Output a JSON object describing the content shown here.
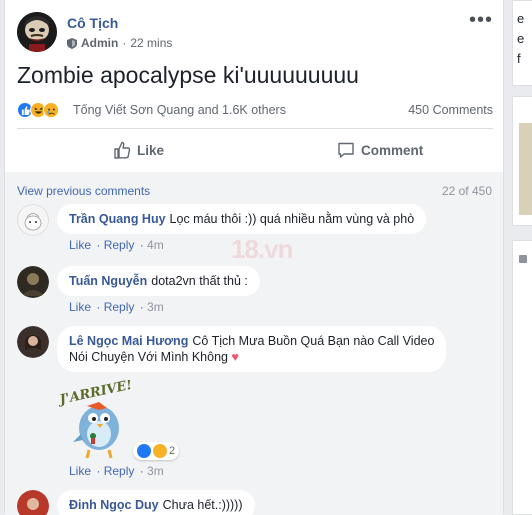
{
  "post": {
    "author": "Cô Tịch",
    "role": "Admin",
    "time": "22 mins",
    "text": "Zombie apocalypse ki'uuuuuuuuu",
    "reactors": "Tống Viết Sơn Quang and 1.6K others",
    "comments_count": "450 Comments",
    "like_label": "Like",
    "comment_label": "Comment"
  },
  "comments_section": {
    "view_previous": "View previous comments",
    "count_of": "22 of 450",
    "items": [
      {
        "name": "Trần Quang Huy",
        "text": "Lọc máu thôi :)) quá nhiều nằm vùng và phò",
        "like": "Like",
        "reply": "Reply",
        "time": "4m"
      },
      {
        "name": "Tuấn Nguyễn",
        "text": "dota2vn thất thủ :",
        "like": "Like",
        "reply": "Reply",
        "time": "3m"
      },
      {
        "name": "Lê Ngọc Mai Hương",
        "text_line1": "Cô Tịch Mưa Buồn Quá Bạn nào Call Video",
        "text_line2": "Nói Chuyện Với Mình Không",
        "sticker_text": "J'ARRIVE!",
        "sticker_reaction_count": "2",
        "like": "Like",
        "reply": "Reply",
        "time": "3m"
      },
      {
        "name": "Đinh Ngọc Duy",
        "text": "Chưa hết.:)))))"
      }
    ]
  },
  "right_column": {
    "fragment_chars": [
      "e",
      "e",
      "f"
    ]
  },
  "colors": {
    "link_blue": "#385898",
    "like_blue": "#2078f4",
    "haha_yellow": "#f7b125",
    "heart": "#f25268"
  }
}
